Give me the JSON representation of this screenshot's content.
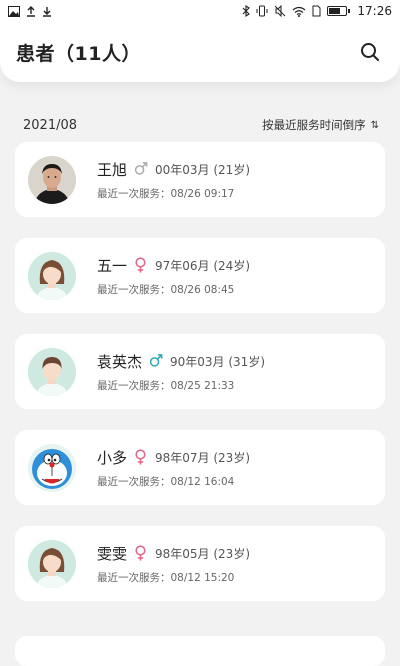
{
  "status_bar": {
    "time": "17:26",
    "left_icons": [
      "image-icon",
      "upload-icon",
      "download-icon"
    ],
    "right_icons": [
      "bluetooth-icon",
      "vibrate-icon",
      "mute-icon",
      "wifi-icon",
      "sim-icon",
      "battery-icon"
    ]
  },
  "header": {
    "title": "患者（11人）",
    "search_icon": "search-icon"
  },
  "sort_bar": {
    "month": "2021/08",
    "sort_label": "按最近服务时间倒序",
    "sort_icon": "⇅"
  },
  "patients": [
    {
      "name": "王旭",
      "gender": "male",
      "gender_color": "#aaaaaa",
      "birth": "00年03月 (21岁)",
      "last_service": "最近一次服务：08/26 09:17",
      "avatar": "photo"
    },
    {
      "name": "五一",
      "gender": "female",
      "gender_color": "#e06a8c",
      "birth": "97年06月 (24岁)",
      "last_service": "最近一次服务：08/26 08:45",
      "avatar": "female"
    },
    {
      "name": "袁英杰",
      "gender": "male",
      "gender_color": "#2aa8b8",
      "birth": "90年03月 (31岁)",
      "last_service": "最近一次服务：08/25 21:33",
      "avatar": "male"
    },
    {
      "name": "小多",
      "gender": "female",
      "gender_color": "#e06a8c",
      "birth": "98年07月 (23岁)",
      "last_service": "最近一次服务：08/12 16:04",
      "avatar": "doraemon"
    },
    {
      "name": "雯雯",
      "gender": "female",
      "gender_color": "#e06a8c",
      "birth": "98年05月 (23岁)",
      "last_service": "最近一次服务：08/12 15:20",
      "avatar": "female"
    }
  ]
}
